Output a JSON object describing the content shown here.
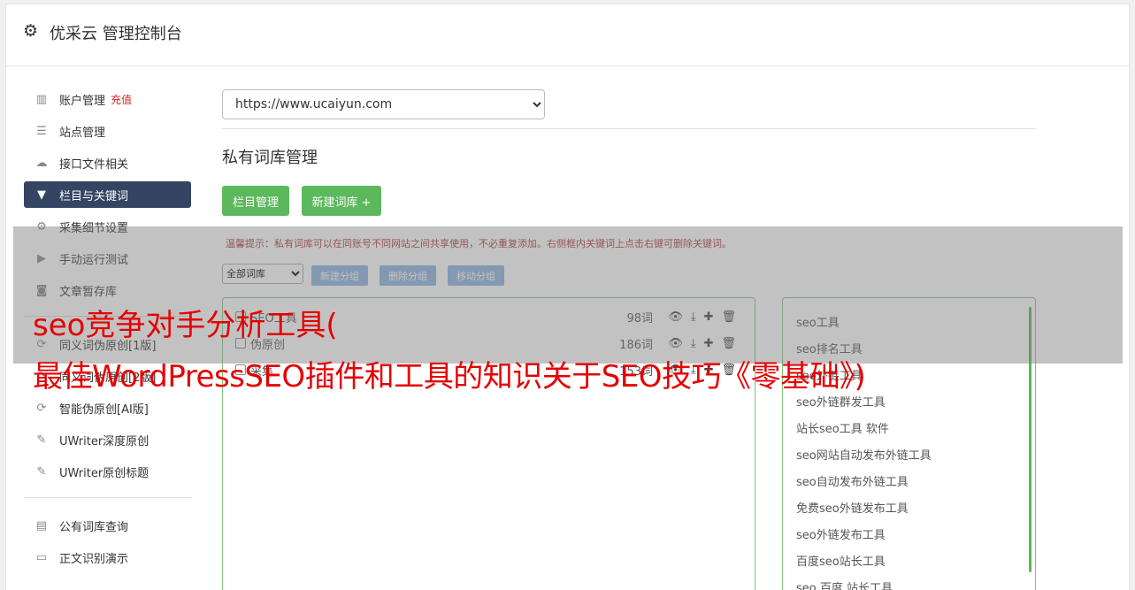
{
  "header": {
    "title": "优采云 管理控制台"
  },
  "sidebar": {
    "items": [
      {
        "icon": "bar-chart-icon",
        "label": "账户管理",
        "badge": "充值"
      },
      {
        "icon": "server-icon",
        "label": "站点管理"
      },
      {
        "icon": "cloud-upload-icon",
        "label": "接口文件相关"
      },
      {
        "icon": "filter-icon",
        "label": "栏目与关键词"
      },
      {
        "icon": "gears-icon",
        "label": "采集细节设置"
      },
      {
        "icon": "play-circle-icon",
        "label": "手动运行测试"
      },
      {
        "icon": "database-icon",
        "label": "文章暂存库"
      },
      {
        "icon": "sync-icon",
        "label": "同义词伪原创[1版]"
      },
      {
        "icon": "sync-icon",
        "label": "同义词伪原创[2版]"
      },
      {
        "icon": "sync-icon",
        "label": "智能伪原创[AI版]"
      },
      {
        "icon": "edit-icon",
        "label": "UWriter深度原创"
      },
      {
        "icon": "edit-icon",
        "label": "UWriter原创标题"
      },
      {
        "icon": "book-icon",
        "label": "公有词库查询"
      },
      {
        "icon": "monitor-icon",
        "label": "正文识别演示"
      }
    ]
  },
  "main": {
    "site_select": "https://www.ucaiyun.com",
    "section_title": "私有词库管理",
    "btn_column": "栏目管理",
    "btn_new_lib": "新建词库 +",
    "tip": "温馨提示：私有词库可以在同账号不同网站之间共享使用，不必重复添加。右侧框内关键词上点击右键可删除关键词。",
    "group_select": "全部词库",
    "btn_new_group": "新建分组",
    "btn_del_group": "删除分组",
    "btn_move_group": "移动分组",
    "libraries": [
      {
        "name": "SEO工具",
        "count": "98词"
      },
      {
        "name": "伪原创",
        "count": "186词"
      },
      {
        "name": "采集",
        "count": "153词"
      }
    ],
    "keywords": [
      "seo工具",
      "seo排名工具",
      "seo外链工具",
      "seo外链群发工具",
      "站长seo工具 软件",
      "seo网站自动发布外链工具",
      "seo自动发布外链工具",
      "免费seo外链发布工具",
      "seo外链发布工具",
      "百度seo站长工具",
      "seo 百度 站长工具"
    ]
  },
  "overlay": {
    "line1": "seo竞争对手分析工具(",
    "line2": "最佳WordPressSEO插件和工具的知识关于SEO技巧《零基础》)"
  }
}
